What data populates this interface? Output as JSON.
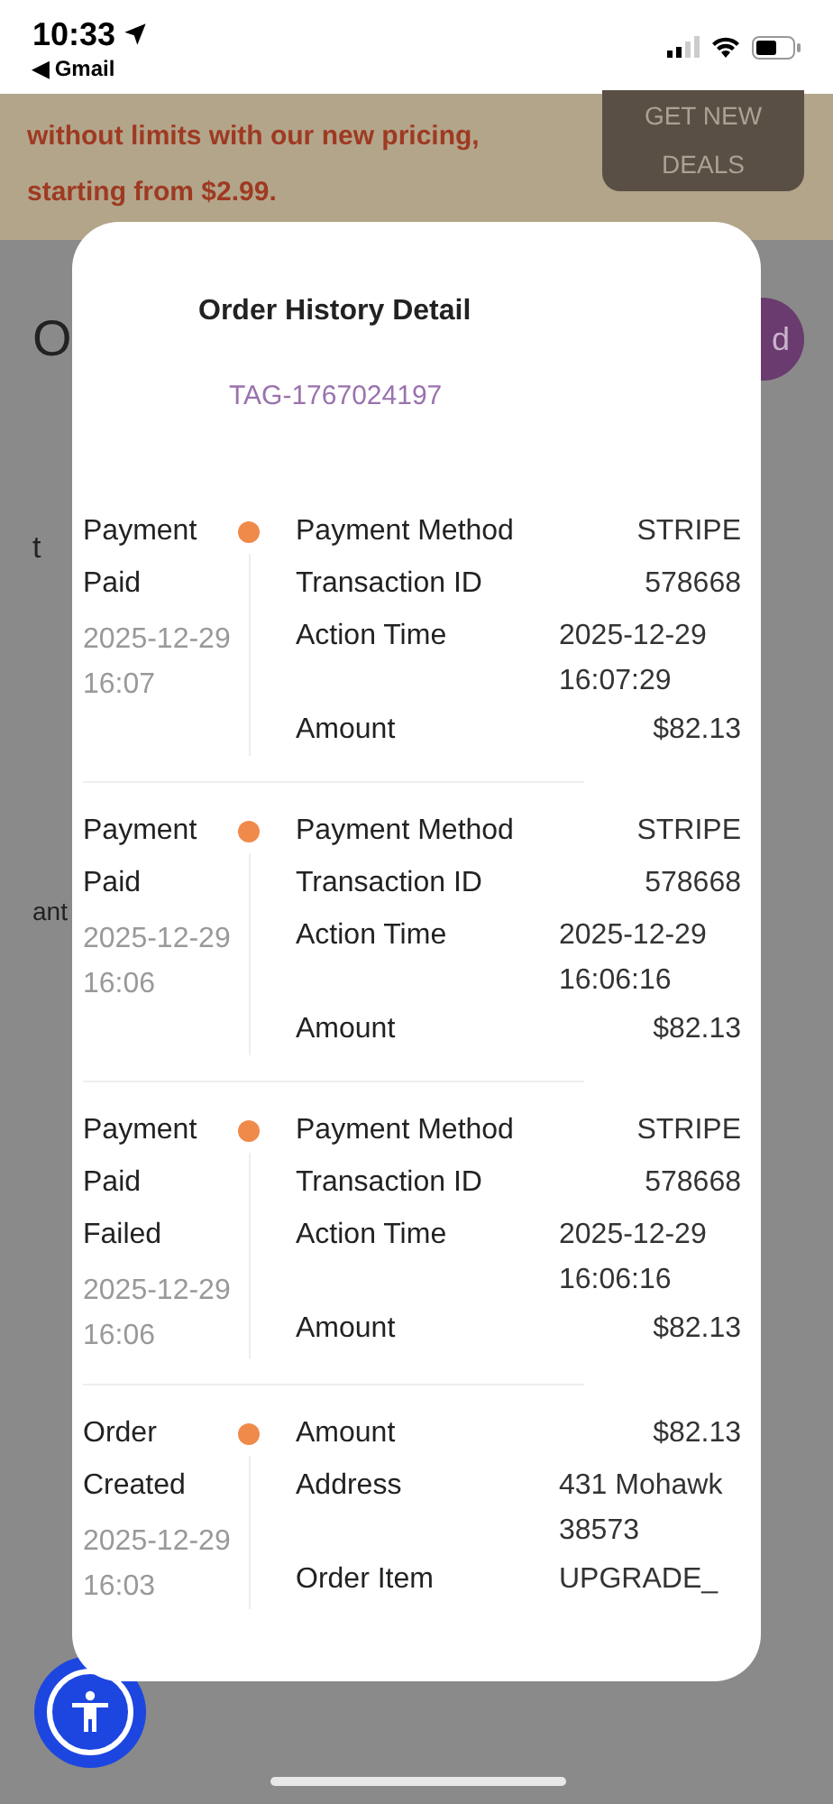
{
  "status_bar": {
    "time": "10:33",
    "back_app": "◀ Gmail"
  },
  "banner": {
    "lines": [
      "without limits with our new pricing,",
      "starting from $2.99."
    ],
    "button": "GET NEW DEALS"
  },
  "background": {
    "heading_fragment": "O",
    "button_fragment": "d",
    "fragments": [
      "t",
      "ant"
    ]
  },
  "modal": {
    "title": "Order History Detail",
    "tag": "TAG-1767024197",
    "entries": [
      {
        "status": [
          "Payment",
          "Paid"
        ],
        "date": "2025-12-29 16:07",
        "fields": [
          {
            "label": "Payment Method",
            "value": "STRIPE",
            "kind": "text"
          },
          {
            "label": "Transaction ID",
            "value": "578668",
            "kind": "text"
          },
          {
            "label": "Action Time",
            "value": "2025-12-29 16:07:29",
            "kind": "wrap"
          },
          {
            "label": "Amount",
            "value": "$82.13",
            "kind": "text"
          }
        ]
      },
      {
        "status": [
          "Payment",
          "Paid"
        ],
        "date": "2025-12-29 16:06",
        "fields": [
          {
            "label": "Payment Method",
            "value": "STRIPE",
            "kind": "text"
          },
          {
            "label": "Transaction ID",
            "value": "578668",
            "kind": "text"
          },
          {
            "label": "Action Time",
            "value": "2025-12-29 16:06:16",
            "kind": "wrap"
          },
          {
            "label": "Amount",
            "value": "$82.13",
            "kind": "text"
          }
        ]
      },
      {
        "status": [
          "Payment",
          "Paid",
          "Failed"
        ],
        "date": "2025-12-29 16:06",
        "fields": [
          {
            "label": "Payment Method",
            "value": "STRIPE",
            "kind": "text"
          },
          {
            "label": "Transaction ID",
            "value": "578668",
            "kind": "text"
          },
          {
            "label": "Action Time",
            "value": "2025-12-29 16:06:16",
            "kind": "wrap"
          },
          {
            "label": "Amount",
            "value": "$82.13",
            "kind": "text"
          }
        ]
      },
      {
        "status": [
          "Order",
          "Created"
        ],
        "date": "2025-12-29 16:03",
        "fields": [
          {
            "label": "Amount",
            "value": "$82.13",
            "kind": "text"
          },
          {
            "label": "Address",
            "value": "431 Mohawk 38573",
            "kind": "wrap"
          },
          {
            "label": "Order Item",
            "value": "UPGRADE_",
            "kind": "wrap"
          }
        ]
      }
    ]
  }
}
